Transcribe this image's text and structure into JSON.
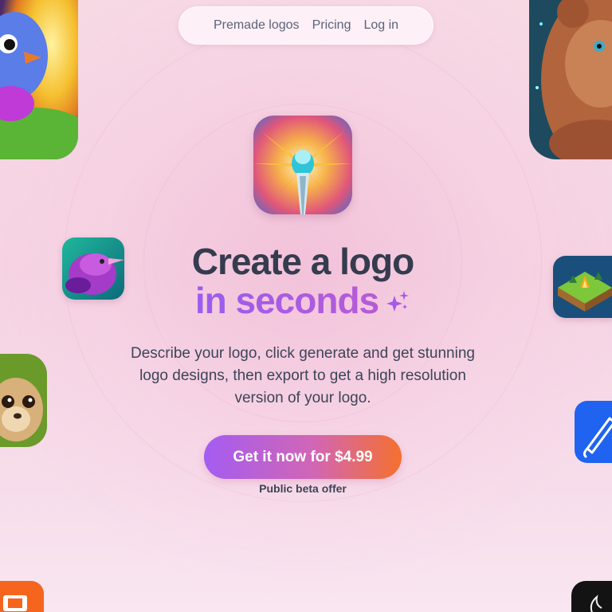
{
  "nav": {
    "items": [
      {
        "label": "Premade logos"
      },
      {
        "label": "Pricing"
      },
      {
        "label": "Log in"
      }
    ]
  },
  "hero": {
    "title_line1": "Create a logo",
    "title_line2": "in seconds",
    "description": "Describe your logo, click generate and get stunning logo designs, then export to get a high resolution version of your logo.",
    "cta_label": "Get it now for $4.99",
    "cta_note": "Public beta offer"
  },
  "icons": {
    "hero": "paintbrush-logo-icon",
    "sparkle": "sparkle-icon",
    "gallery": [
      "blue-bird-logo",
      "bear-logo",
      "purple-bird-logo",
      "campfire-island-logo",
      "meerkat-logo",
      "pen-logo",
      "orange-logo",
      "dark-logo"
    ]
  },
  "colors": {
    "accent_purple": "#a65ae6",
    "cta_start": "#a45cf2",
    "cta_end": "#f5702e",
    "heading": "#343c4e",
    "background": "#f5d3e3"
  }
}
